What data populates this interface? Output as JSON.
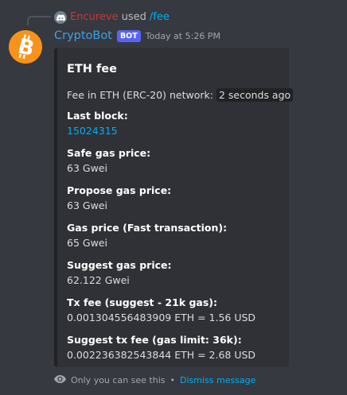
{
  "reply": {
    "user": "Encureve",
    "verb": "used",
    "command": "/fee"
  },
  "message": {
    "author": "CryptoBot",
    "bot_tag": "BOT",
    "timestamp": "Today at 5:26 PM"
  },
  "embed": {
    "title": "ETH fee",
    "description_prefix": "Fee in ETH (ERC-20) network:",
    "description_code": "2 seconds ago",
    "fields": [
      {
        "name": "Last block:",
        "value": "15024315"
      },
      {
        "name": "Safe gas price:",
        "value": "63 Gwei"
      },
      {
        "name": "Propose gas price:",
        "value": "63 Gwei"
      },
      {
        "name": "Gas price (Fast transaction):",
        "value": "65 Gwei"
      },
      {
        "name": "Suggest gas price:",
        "value": "62.122 Gwei"
      },
      {
        "name": "Tx fee (suggest - 21k gas):",
        "value": "0.001304556483909 ETH = 1.56 USD"
      },
      {
        "name": "Suggest tx fee (gas limit: 36k):",
        "value": "0.002236382543844 ETH = 2.68 USD"
      }
    ],
    "accent_color": "#202225"
  },
  "ephemeral": {
    "notice": "Only you can see this",
    "separator": "•",
    "dismiss": "Dismiss message"
  },
  "icons": {
    "avatar": "bitcoin-icon",
    "mini_avatar": "discord-icon",
    "visibility": "eye-icon"
  },
  "colors": {
    "background": "#36393f",
    "embed_background": "#2f3136",
    "username": "#3ba2ec",
    "reply_user": "#c13b3b",
    "link": "#00aff4",
    "bot_tag": "#5865f2",
    "avatar": "#f7931a"
  }
}
